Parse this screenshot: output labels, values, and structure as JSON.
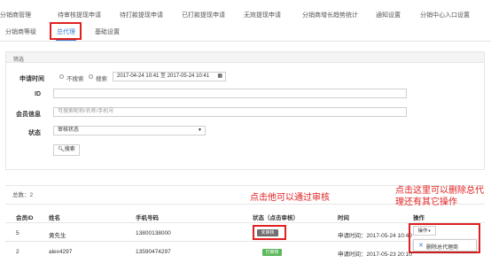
{
  "top_nav": [
    "分销商管理",
    "待审核提现申请",
    "待打款提现申请",
    "已打款提现申请",
    "无效提现申请",
    "分销商增长趋势统计",
    "通知设置",
    "分销中心入口设置"
  ],
  "sub_nav": [
    "分销商等级",
    "总代理",
    "基础设置"
  ],
  "filter": {
    "panel_title": "筛选",
    "apply_time_label": "申请时间",
    "radio_no_search": "不搜索",
    "radio_search": "搜索",
    "date_range": "2017-04-24 10:41 至 2017-05-24 10:41",
    "id_label": "ID",
    "member_label": "会员信息",
    "member_placeholder": "可搜索昵称/名称/手机号",
    "status_label": "状态",
    "status_selected": "审核状态",
    "search_button": "搜索"
  },
  "list": {
    "total": "总数：2",
    "headers": [
      "会员ID",
      "姓名",
      "手机号码",
      "状态（点击审核）",
      "时间",
      "操作"
    ],
    "rows": [
      {
        "id": "5",
        "name": "黄先生",
        "phone": "13800138000",
        "status": "未审核",
        "time": "申请时间：2017-05-24 10:40",
        "action": "操作"
      },
      {
        "id": "2",
        "name": "alex4297",
        "phone": "13590474297",
        "status": "已审核",
        "time": "申请时间：2017-05-23 20:10",
        "action": ""
      }
    ]
  },
  "dropdown": {
    "delete_label": "删除总代理商"
  },
  "annotations": {
    "audit_note": "点击他可以通过审核",
    "delete_note_line1": "点击这里可以删除总代",
    "delete_note_line2": "理还有其它操作"
  },
  "colors": {
    "accent": "#3a7fd5",
    "annotation_red": "#e02020",
    "pending_badge": "#6f6f6f",
    "approved_badge": "#5cb85c"
  }
}
